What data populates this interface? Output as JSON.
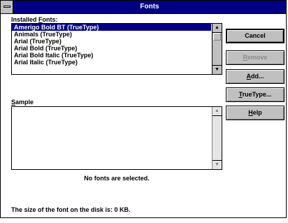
{
  "window": {
    "title": "Fonts",
    "system_menu_icon": "minus-bar-icon"
  },
  "installed_fonts": {
    "label_pre": "Installed ",
    "label_u": "F",
    "label_post": "onts:",
    "items": [
      "Amerigo Bold BT (TrueType)",
      "Animals (TrueType)",
      "Arial (TrueType)",
      "Arial Bold (TrueType)",
      "Arial Bold Italic (TrueType)",
      "Arial Italic (TrueType)"
    ],
    "selected_index": 0,
    "scroll_up_glyph": "▲",
    "scroll_down_glyph": "▼"
  },
  "sample": {
    "label_u": "S",
    "label_post": "ample",
    "scroll_up_glyph": "▲",
    "scroll_down_glyph": "▼"
  },
  "status": {
    "message": "No fonts are selected.",
    "disk_size": "The size of the font on the disk is:  0 KB."
  },
  "buttons": {
    "cancel": "Cancel",
    "remove_u": "R",
    "remove_post": "emove",
    "add_u": "A",
    "add_post": "dd...",
    "truetype_u": "T",
    "truetype_post": "rueType...",
    "help_u": "H",
    "help_post": "elp"
  },
  "colors": {
    "titlebar": "#000080",
    "selection": "#000080",
    "button_face": "#c0c0c0"
  }
}
